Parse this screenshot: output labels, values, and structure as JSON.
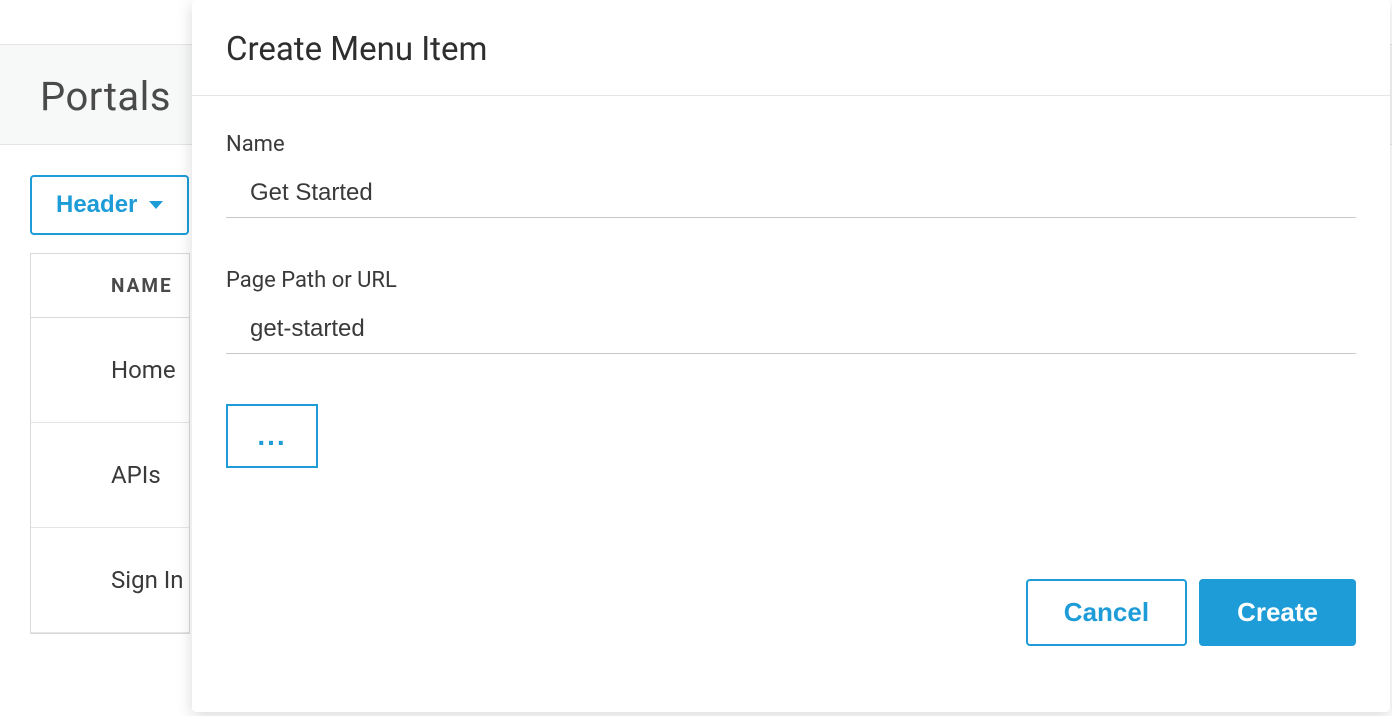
{
  "page": {
    "title": "Portals"
  },
  "dropdown": {
    "label": "Header"
  },
  "table": {
    "column_header": "NAME",
    "rows": [
      {
        "label": "Home"
      },
      {
        "label": "APIs"
      },
      {
        "label": "Sign In"
      }
    ]
  },
  "modal": {
    "title": "Create Menu Item",
    "fields": {
      "name": {
        "label": "Name",
        "value": "Get Started"
      },
      "path": {
        "label": "Page Path or URL",
        "value": "get-started"
      }
    },
    "more_label": "...",
    "buttons": {
      "cancel": "Cancel",
      "create": "Create"
    }
  }
}
